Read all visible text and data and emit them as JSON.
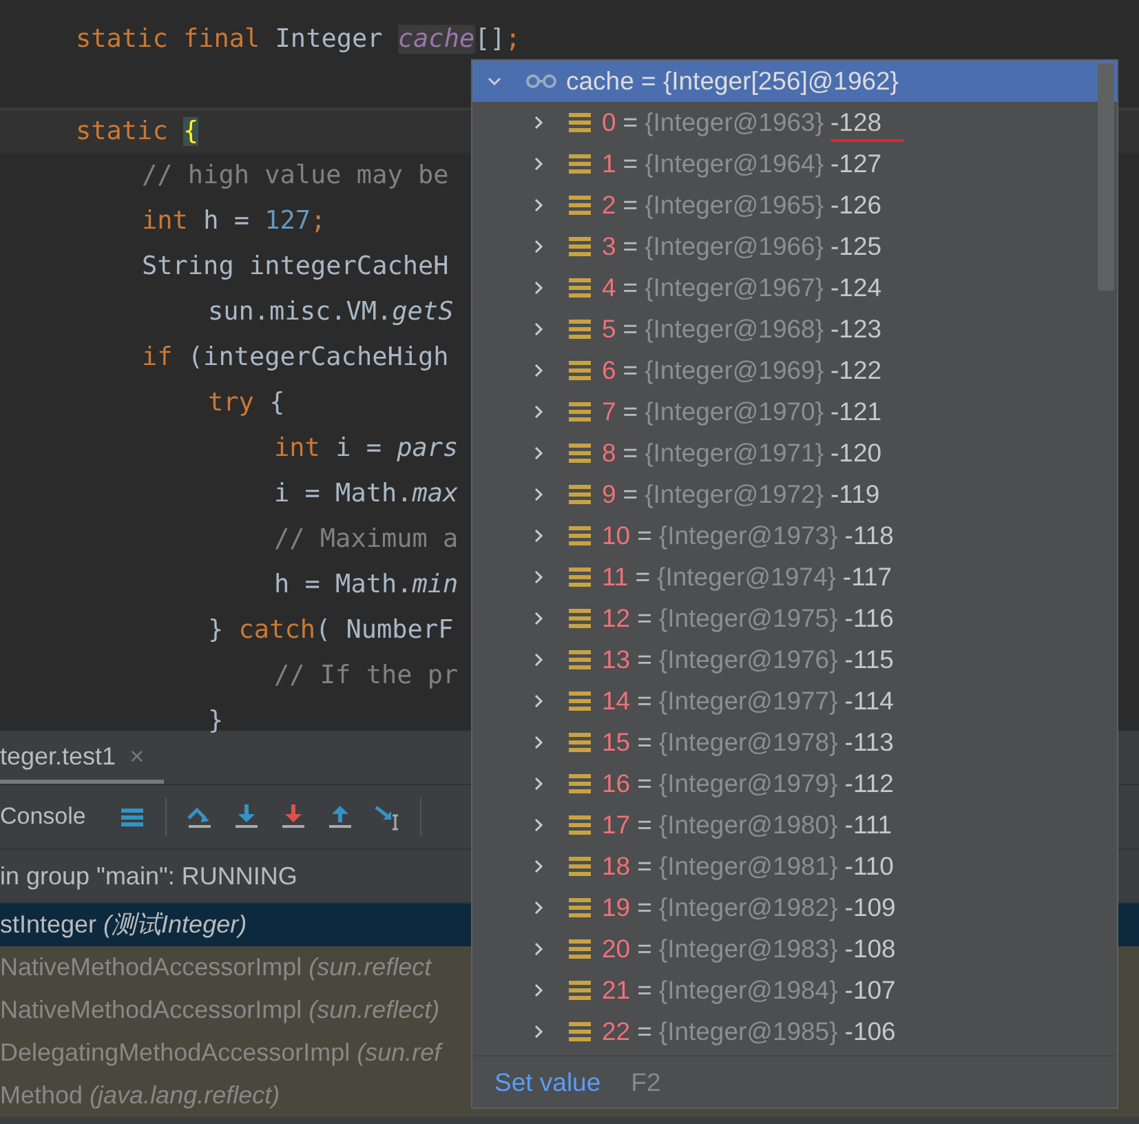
{
  "editor": {
    "lines": [
      {
        "kind": "code",
        "tokens": [
          {
            "t": "static final ",
            "kind": "kw"
          },
          {
            "t": "Integer ",
            "kind": "plain"
          },
          {
            "t": "cache",
            "kind": "field"
          },
          {
            "t": "[]",
            "kind": "plain"
          },
          {
            "t": ";",
            "kind": "kw"
          }
        ]
      },
      {
        "kind": "blank"
      },
      {
        "kind": "code",
        "current": true,
        "tokens": [
          {
            "t": "static ",
            "kind": "kw"
          },
          {
            "t": "{",
            "kind": "brace"
          }
        ],
        "children": [
          {
            "kind": "code",
            "tokens": [
              {
                "t": "// high value may be",
                "kind": "comment"
              }
            ]
          },
          {
            "kind": "code",
            "tokens": [
              {
                "t": "int ",
                "kind": "kw"
              },
              {
                "t": "h = ",
                "kind": "plain"
              },
              {
                "t": "127",
                "kind": "num"
              },
              {
                "t": ";",
                "kind": "kw"
              }
            ]
          },
          {
            "kind": "code",
            "tokens": [
              {
                "t": "String integerCacheH",
                "kind": "plain"
              }
            ],
            "children": [
              {
                "kind": "code",
                "tokens": [
                  {
                    "t": "sun.misc.VM.",
                    "kind": "plain"
                  },
                  {
                    "t": "getS",
                    "kind": "method"
                  }
                ]
              }
            ]
          },
          {
            "kind": "code",
            "tokens": [
              {
                "t": "if ",
                "kind": "kw"
              },
              {
                "t": "(integerCacheHigh",
                "kind": "plain"
              }
            ],
            "children": [
              {
                "kind": "code",
                "tokens": [
                  {
                    "t": "try ",
                    "kind": "kw"
                  },
                  {
                    "t": "{",
                    "kind": "plain"
                  }
                ],
                "children": [
                  {
                    "kind": "code",
                    "tokens": [
                      {
                        "t": "int ",
                        "kind": "kw"
                      },
                      {
                        "t": "i = ",
                        "kind": "plain"
                      },
                      {
                        "t": "pars",
                        "kind": "method"
                      }
                    ]
                  },
                  {
                    "kind": "code",
                    "tokens": [
                      {
                        "t": "i = Math.",
                        "kind": "plain"
                      },
                      {
                        "t": "max",
                        "kind": "method"
                      }
                    ]
                  },
                  {
                    "kind": "code",
                    "tokens": [
                      {
                        "t": "// Maximum a",
                        "kind": "comment"
                      }
                    ]
                  },
                  {
                    "kind": "code",
                    "tokens": [
                      {
                        "t": "h = Math.",
                        "kind": "plain"
                      },
                      {
                        "t": "min",
                        "kind": "method"
                      }
                    ]
                  }
                ]
              },
              {
                "kind": "code",
                "tokens": [
                  {
                    "t": "} ",
                    "kind": "plain"
                  },
                  {
                    "t": "catch",
                    "kind": "kw"
                  },
                  {
                    "t": "( NumberF",
                    "kind": "plain"
                  }
                ],
                "children": [
                  {
                    "kind": "code",
                    "tokens": [
                      {
                        "t": "// If the pr",
                        "kind": "comment"
                      }
                    ]
                  }
                ]
              },
              {
                "kind": "code",
                "tokens": [
                  {
                    "t": "}",
                    "kind": "plain"
                  }
                ]
              }
            ]
          }
        ]
      }
    ]
  },
  "debug": {
    "tabs": [
      {
        "label": "teger.test1",
        "close": "×",
        "selected": true
      }
    ],
    "console_label": "Console",
    "thread": "in group \"main\": RUNNING",
    "frames": [
      {
        "name": "stInteger",
        "pkg": "(测试Integer)",
        "selected": true
      },
      {
        "name": "NativeMethodAccessorImpl",
        "pkg": "(sun.reflect",
        "selected": false
      },
      {
        "name": "NativeMethodAccessorImpl",
        "pkg": "(sun.reflect)",
        "selected": false
      },
      {
        "name": "DelegatingMethodAccessorImpl",
        "pkg": "(sun.ref",
        "selected": false
      },
      {
        "name": "Method",
        "pkg": "(java.lang.reflect)",
        "selected": false
      }
    ]
  },
  "popup": {
    "root": {
      "name": "cache",
      "sep": "=",
      "value": "{Integer[256]@1962}",
      "selected": true,
      "expanded": true
    },
    "items": [
      {
        "index": "0",
        "sep": "=",
        "ref": "{Integer@1963}",
        "value": "-128",
        "underlined": true,
        "selected": false,
        "expanded": false
      },
      {
        "index": "1",
        "sep": "=",
        "ref": "{Integer@1964}",
        "value": "-127",
        "underlined": false,
        "selected": false,
        "expanded": false
      },
      {
        "index": "2",
        "sep": "=",
        "ref": "{Integer@1965}",
        "value": "-126",
        "underlined": false,
        "selected": false,
        "expanded": false
      },
      {
        "index": "3",
        "sep": "=",
        "ref": "{Integer@1966}",
        "value": "-125",
        "underlined": false,
        "selected": false,
        "expanded": false
      },
      {
        "index": "4",
        "sep": "=",
        "ref": "{Integer@1967}",
        "value": "-124",
        "underlined": false,
        "selected": false,
        "expanded": false
      },
      {
        "index": "5",
        "sep": "=",
        "ref": "{Integer@1968}",
        "value": "-123",
        "underlined": false,
        "selected": false,
        "expanded": false
      },
      {
        "index": "6",
        "sep": "=",
        "ref": "{Integer@1969}",
        "value": "-122",
        "underlined": false,
        "selected": false,
        "expanded": false
      },
      {
        "index": "7",
        "sep": "=",
        "ref": "{Integer@1970}",
        "value": "-121",
        "underlined": false,
        "selected": false,
        "expanded": false
      },
      {
        "index": "8",
        "sep": "=",
        "ref": "{Integer@1971}",
        "value": "-120",
        "underlined": false,
        "selected": false,
        "expanded": false
      },
      {
        "index": "9",
        "sep": "=",
        "ref": "{Integer@1972}",
        "value": "-119",
        "underlined": false,
        "selected": false,
        "expanded": false
      },
      {
        "index": "10",
        "sep": "=",
        "ref": "{Integer@1973}",
        "value": "-118",
        "underlined": false,
        "selected": false,
        "expanded": false
      },
      {
        "index": "11",
        "sep": "=",
        "ref": "{Integer@1974}",
        "value": "-117",
        "underlined": false,
        "selected": false,
        "expanded": false
      },
      {
        "index": "12",
        "sep": "=",
        "ref": "{Integer@1975}",
        "value": "-116",
        "underlined": false,
        "selected": false,
        "expanded": false
      },
      {
        "index": "13",
        "sep": "=",
        "ref": "{Integer@1976}",
        "value": "-115",
        "underlined": false,
        "selected": false,
        "expanded": false
      },
      {
        "index": "14",
        "sep": "=",
        "ref": "{Integer@1977}",
        "value": "-114",
        "underlined": false,
        "selected": false,
        "expanded": false
      },
      {
        "index": "15",
        "sep": "=",
        "ref": "{Integer@1978}",
        "value": "-113",
        "underlined": false,
        "selected": false,
        "expanded": false
      },
      {
        "index": "16",
        "sep": "=",
        "ref": "{Integer@1979}",
        "value": "-112",
        "underlined": false,
        "selected": false,
        "expanded": false
      },
      {
        "index": "17",
        "sep": "=",
        "ref": "{Integer@1980}",
        "value": "-111",
        "underlined": false,
        "selected": false,
        "expanded": false
      },
      {
        "index": "18",
        "sep": "=",
        "ref": "{Integer@1981}",
        "value": "-110",
        "underlined": false,
        "selected": false,
        "expanded": false
      },
      {
        "index": "19",
        "sep": "=",
        "ref": "{Integer@1982}",
        "value": "-109",
        "underlined": false,
        "selected": false,
        "expanded": false
      },
      {
        "index": "20",
        "sep": "=",
        "ref": "{Integer@1983}",
        "value": "-108",
        "underlined": false,
        "selected": false,
        "expanded": false
      },
      {
        "index": "21",
        "sep": "=",
        "ref": "{Integer@1984}",
        "value": "-107",
        "underlined": false,
        "selected": false,
        "expanded": false
      },
      {
        "index": "22",
        "sep": "=",
        "ref": "{Integer@1985}",
        "value": "-106",
        "underlined": false,
        "selected": false,
        "expanded": false
      }
    ],
    "footer": {
      "action": "Set value",
      "shortcut": "F2"
    }
  }
}
